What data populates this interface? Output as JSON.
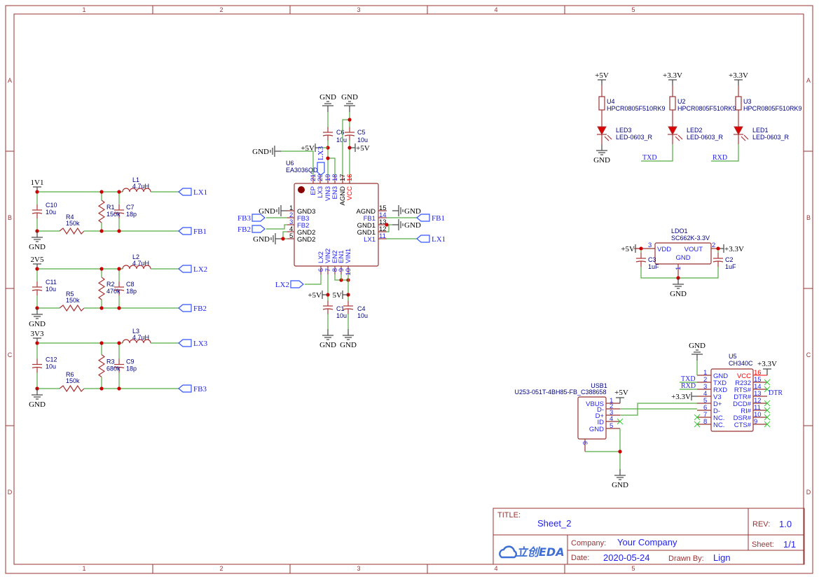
{
  "colors": {
    "wire": "#55aa44",
    "part": "#aa3333",
    "text": "#2222ee",
    "power_pin": "#ff0000",
    "junction": "#cc0000"
  },
  "frame": {
    "columns": [
      "1",
      "2",
      "3",
      "4",
      "5"
    ],
    "rows": [
      "A",
      "B",
      "C",
      "D"
    ]
  },
  "regulators": [
    {
      "supply": "1V1",
      "gnd": "GND",
      "c_in": {
        "ref": "C10",
        "value": "10u"
      },
      "r_bot": {
        "ref": "R4",
        "value": "150k"
      },
      "r_top": {
        "ref": "R1",
        "value": "150k"
      },
      "c_ff": {
        "ref": "C7",
        "value": "18p"
      },
      "inductor": {
        "ref": "L1",
        "value": "4.7uH"
      },
      "lx": "LX1",
      "fb": "FB1"
    },
    {
      "supply": "2V5",
      "gnd": "GND",
      "c_in": {
        "ref": "C11",
        "value": "10u"
      },
      "r_bot": {
        "ref": "R5",
        "value": "150k"
      },
      "r_top": {
        "ref": "R2",
        "value": "470k"
      },
      "c_ff": {
        "ref": "C8",
        "value": "18p"
      },
      "inductor": {
        "ref": "L2",
        "value": "4.7uH"
      },
      "lx": "LX2",
      "fb": "FB2"
    },
    {
      "supply": "3V3",
      "gnd": "GND",
      "c_in": {
        "ref": "C12",
        "value": "10u"
      },
      "r_bot": {
        "ref": "R6",
        "value": "150k"
      },
      "r_top": {
        "ref": "R3",
        "value": "680k"
      },
      "c_ff": {
        "ref": "C9",
        "value": "18p"
      },
      "inductor": {
        "ref": "L3",
        "value": "4.7uH"
      },
      "lx": "LX3",
      "fb": "FB3"
    }
  ],
  "u6": {
    "ref": "U6",
    "value": "EA3036QDR",
    "pins_top": [
      {
        "num": "21",
        "name": "EP",
        "type": "signal"
      },
      {
        "num": "20",
        "name": "LX3",
        "type": "signal"
      },
      {
        "num": "19",
        "name": "VIN3",
        "type": "signal"
      },
      {
        "num": "18",
        "name": "EN3",
        "type": "signal"
      },
      {
        "num": "17",
        "name": "AGND",
        "type": "gnd"
      },
      {
        "num": "16",
        "name": "VCC",
        "type": "power"
      }
    ],
    "pins_left": [
      {
        "num": "1",
        "name": "GND3",
        "type": "gnd"
      },
      {
        "num": "2",
        "name": "FB3",
        "type": "signal"
      },
      {
        "num": "3",
        "name": "FB2",
        "type": "signal"
      },
      {
        "num": "4",
        "name": "GND2",
        "type": "gnd"
      },
      {
        "num": "5",
        "name": "GND2",
        "type": "gnd"
      }
    ],
    "pins_right": [
      {
        "num": "15",
        "name": "AGND",
        "type": "gnd"
      },
      {
        "num": "14",
        "name": "FB1",
        "type": "signal"
      },
      {
        "num": "13",
        "name": "GND1",
        "type": "gnd"
      },
      {
        "num": "12",
        "name": "GND1",
        "type": "gnd"
      },
      {
        "num": "11",
        "name": "LX1",
        "type": "signal"
      }
    ],
    "pins_bottom": [
      {
        "num": "6",
        "name": "LX2",
        "type": "signal"
      },
      {
        "num": "7",
        "name": "VIN2",
        "type": "signal"
      },
      {
        "num": "8",
        "name": "EN2",
        "type": "signal"
      },
      {
        "num": "9",
        "name": "EN1",
        "type": "signal"
      },
      {
        "num": "10",
        "name": "VIN1",
        "type": "signal"
      }
    ],
    "caps": [
      {
        "ref": "C6",
        "value": "10u"
      },
      {
        "ref": "C5",
        "value": "10u"
      },
      {
        "ref": "C1",
        "value": "10u"
      },
      {
        "ref": "C4",
        "value": "10u"
      }
    ],
    "nets": {
      "gnd": "GND",
      "p5v": "+5V",
      "p5v_short": "5V",
      "lx3": "LX3",
      "lx2": "LX2",
      "fb3": "FB3",
      "fb2": "FB2",
      "fb1": "FB1",
      "lx1": "LX1"
    }
  },
  "leds": [
    {
      "supply": "+5V",
      "res_ref": "U4",
      "res_value": "HPCR0805F510RK9",
      "led_ref": "LED3",
      "led_value": "LED-0603_R",
      "net": "GND"
    },
    {
      "supply": "+3.3V",
      "res_ref": "U2",
      "res_value": "HPCR0805F510RK9",
      "led_ref": "LED2",
      "led_value": "LED-0603_R",
      "net": "TXD"
    },
    {
      "supply": "+3.3V",
      "res_ref": "U3",
      "res_value": "HPCR0805F510RK9",
      "led_ref": "LED1",
      "led_value": "LED-0603_R",
      "net": "RXD"
    }
  ],
  "ldo": {
    "ref": "LDO1",
    "value": "SC662K-3.3V",
    "pin_vdd": {
      "num": "3",
      "name": "VDD"
    },
    "pin_vout": {
      "num": "2",
      "name": "VOUT"
    },
    "pin_gnd": {
      "num": "1",
      "name": "GND"
    },
    "in": "+5V",
    "out": "+3.3V",
    "gnd": "GND",
    "c_in": {
      "ref": "C3",
      "value": "1uF"
    },
    "c_out": {
      "ref": "C2",
      "value": "1uF"
    }
  },
  "usb": {
    "ref": "USB1",
    "value": "U253-051T-4BH85-FB_C388658",
    "pins": [
      {
        "num": "1",
        "name": "VBUS"
      },
      {
        "num": "2",
        "name": "D-"
      },
      {
        "num": "3",
        "name": "D+"
      },
      {
        "num": "4",
        "name": "ID"
      },
      {
        "num": "5",
        "name": "GND"
      }
    ],
    "shield_pin": "6",
    "vbus_net": "+5V",
    "gnd": "GND"
  },
  "u5": {
    "ref": "U5",
    "value": "CH340C",
    "pins_left": [
      {
        "num": "1",
        "name": "GND"
      },
      {
        "num": "2",
        "name": "TXD"
      },
      {
        "num": "3",
        "name": "RXD"
      },
      {
        "num": "4",
        "name": "V3"
      },
      {
        "num": "5",
        "name": "D+"
      },
      {
        "num": "6",
        "name": "D-"
      },
      {
        "num": "7",
        "name": "NC."
      },
      {
        "num": "8",
        "name": "NC."
      }
    ],
    "pins_right": [
      {
        "num": "16",
        "name": "VCC",
        "type": "power"
      },
      {
        "num": "15",
        "name": "R232"
      },
      {
        "num": "14",
        "name": "RTS#"
      },
      {
        "num": "13",
        "name": "DTR#"
      },
      {
        "num": "12",
        "name": "DCD#"
      },
      {
        "num": "11",
        "name": "RI#"
      },
      {
        "num": "10",
        "name": "DSR#"
      },
      {
        "num": "9",
        "name": "CTS#"
      }
    ],
    "nets": {
      "gnd": "GND",
      "txd": "TXD",
      "rxd": "RXD",
      "v3": "+3.3V",
      "vcc": "+3.3V",
      "dtr": "DTR"
    }
  },
  "title_block": {
    "title_label": "TITLE:",
    "title": "Sheet_2",
    "rev_label": "REV:",
    "rev": "1.0",
    "company_label": "Company:",
    "company": "Your Company",
    "sheet_label": "Sheet:",
    "sheet": "1/1",
    "date_label": "Date:",
    "date": "2020-05-24",
    "drawn_label": "Drawn By:",
    "drawn_by": "Lign",
    "logo": "立创EDA"
  }
}
